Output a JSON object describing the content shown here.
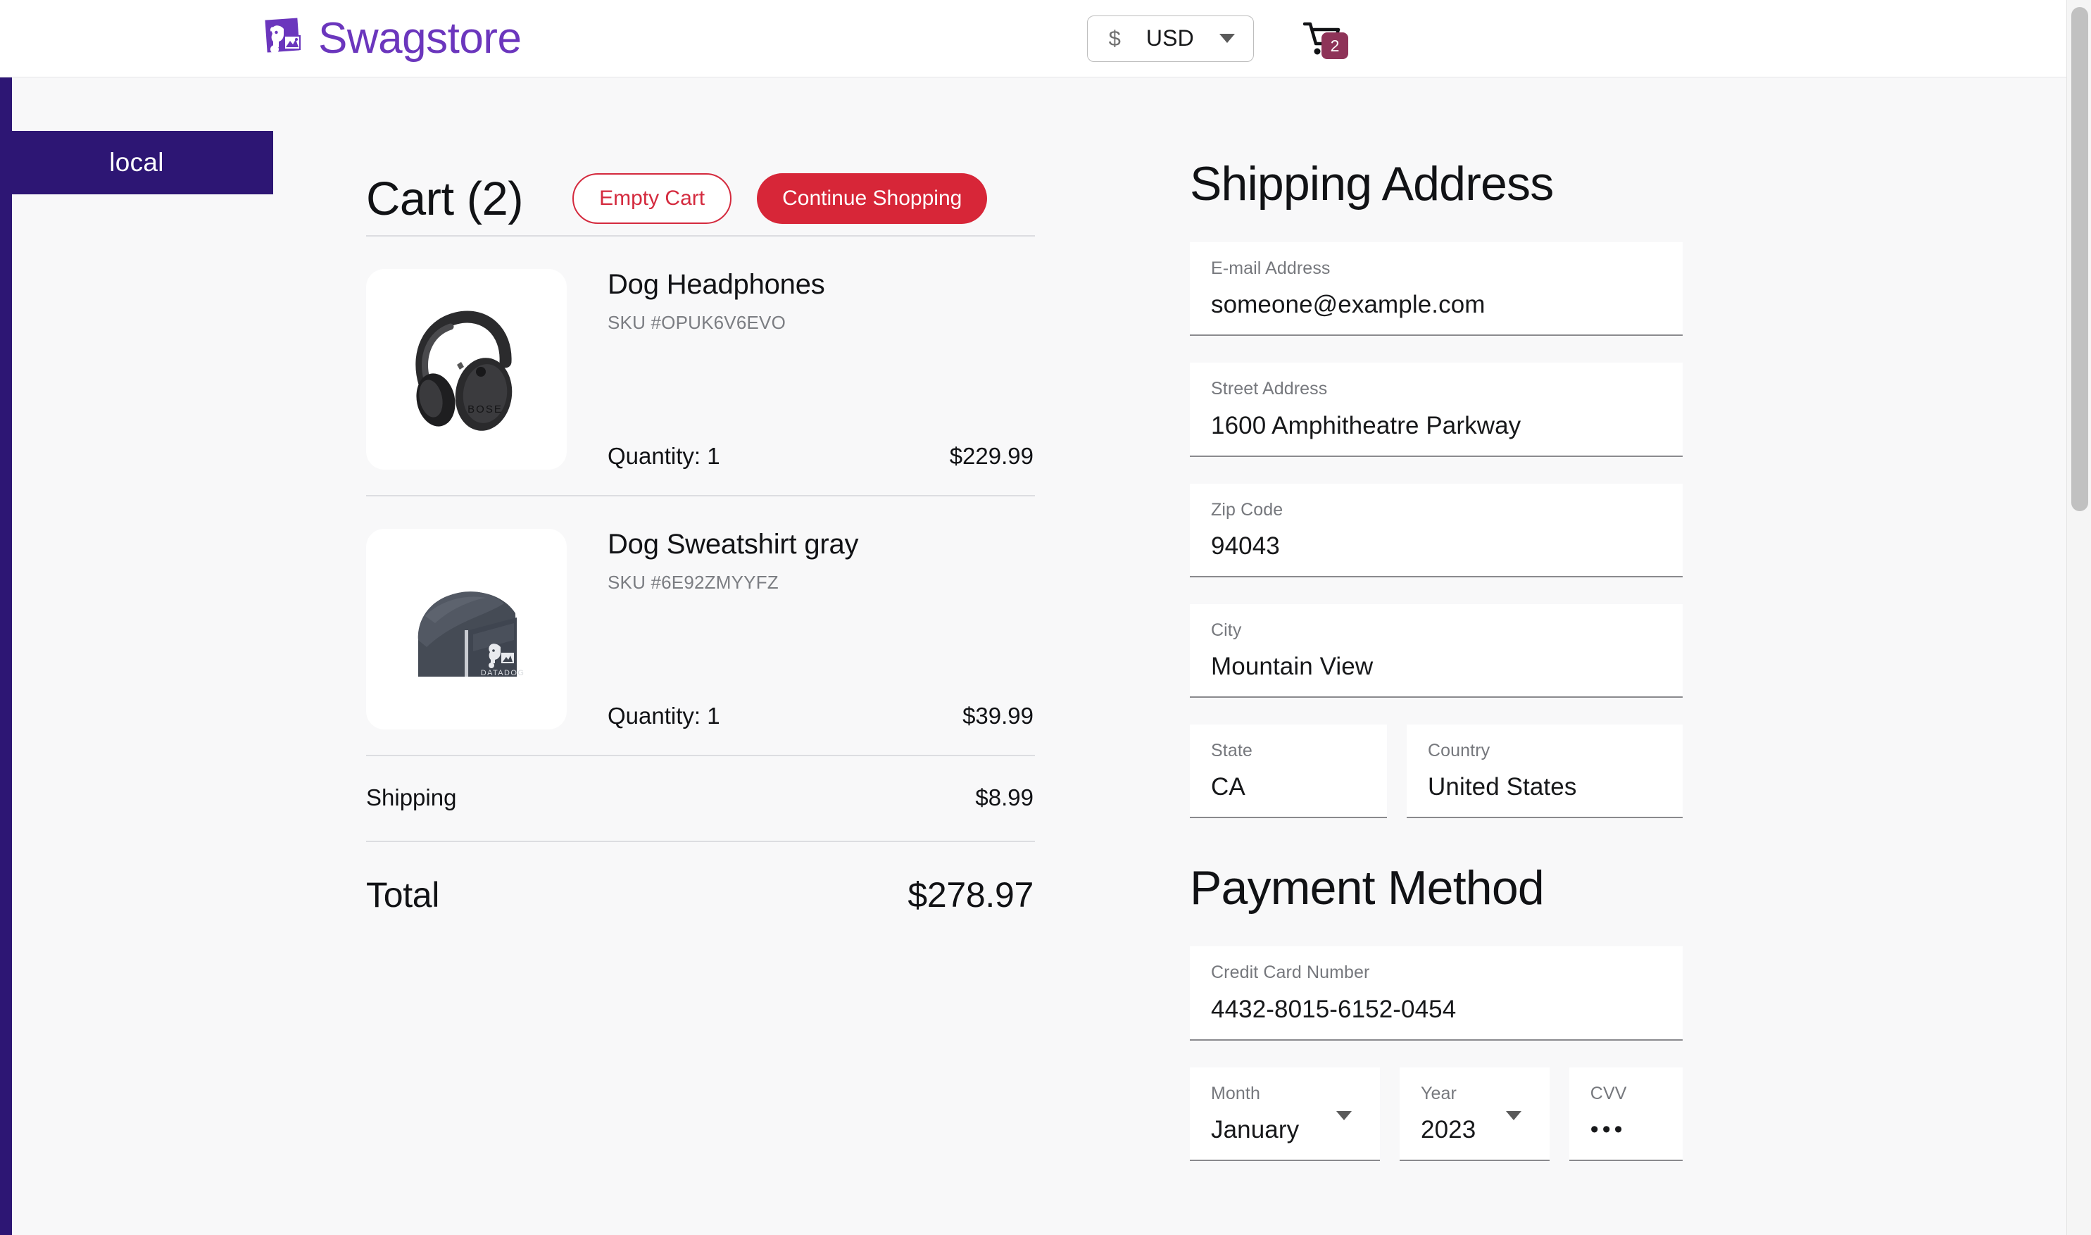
{
  "header": {
    "brand_name": "Swagstore",
    "brand_logo_icon": "datadog-dog-logo-icon",
    "brand_color": "#6b36bd",
    "currency": {
      "symbol": "$",
      "code": "USD",
      "caret_icon": "chevron-down-icon"
    },
    "cart": {
      "icon": "shopping-cart-icon",
      "badge_count": "2",
      "badge_color": "#8e3358"
    }
  },
  "env_banner": {
    "label": "local",
    "color": "#2d1674"
  },
  "cart": {
    "title": "Cart (2)",
    "empty_button": "Empty Cart",
    "continue_button": "Continue Shopping",
    "accent_red": "#d72638",
    "items": [
      {
        "name": "Dog Headphones",
        "sku": "SKU #OPUK6V6EVO",
        "quantity": "Quantity: 1",
        "price": "$229.99",
        "image_icon": "headphones-product-image"
      },
      {
        "name": "Dog Sweatshirt gray",
        "sku": "SKU #6E92ZMYYFZ",
        "quantity": "Quantity: 1",
        "price": "$39.99",
        "image_icon": "sweatshirt-product-image"
      }
    ],
    "shipping_label": "Shipping",
    "shipping_value": "$8.99",
    "total_label": "Total",
    "total_value": "$278.97"
  },
  "shipping": {
    "title": "Shipping Address",
    "email": {
      "label": "E-mail Address",
      "value": "someone@example.com"
    },
    "street": {
      "label": "Street Address",
      "value": "1600 Amphitheatre Parkway"
    },
    "zip": {
      "label": "Zip Code",
      "value": "94043"
    },
    "city": {
      "label": "City",
      "value": "Mountain View"
    },
    "state": {
      "label": "State",
      "value": "CA"
    },
    "country": {
      "label": "Country",
      "value": "United States"
    }
  },
  "payment": {
    "title": "Payment Method",
    "card": {
      "label": "Credit Card Number",
      "value": "4432-8015-6152-0454"
    },
    "month": {
      "label": "Month",
      "value": "January"
    },
    "year": {
      "label": "Year",
      "value": "2023"
    },
    "cvv": {
      "label": "CVV",
      "value": "•••"
    }
  }
}
